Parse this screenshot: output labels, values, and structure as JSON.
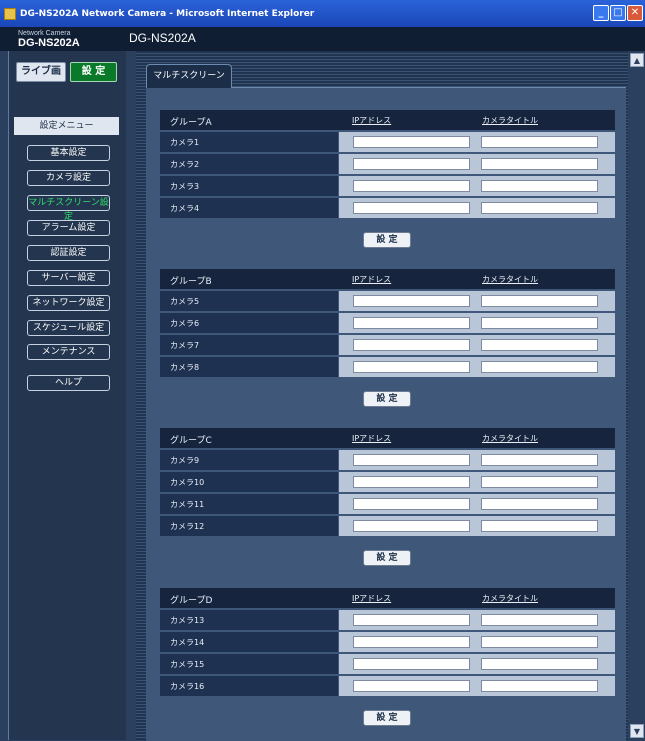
{
  "window": {
    "title": "DG-NS202A Network Camera - Microsoft Internet Explorer"
  },
  "header": {
    "brand_small": "Network Camera",
    "brand": "DG-NS202A",
    "title": "DG-NS202A"
  },
  "modes": {
    "live": "ライブ画",
    "setup": "設 定"
  },
  "menu": {
    "title": "設定メニュー",
    "items": [
      "基本設定",
      "カメラ設定",
      "マルチスクリーン設定",
      "アラーム設定",
      "認証設定",
      "サーバー設定",
      "ネットワーク設定",
      "スケジュール設定",
      "メンテナンス",
      "ヘルプ"
    ],
    "active_index": 2
  },
  "tab": "マルチスクリーン",
  "columns": {
    "ip": "IPアドレス",
    "title": "カメラタイトル"
  },
  "groups": [
    {
      "name": "グループA",
      "cameras": [
        "カメラ1",
        "カメラ2",
        "カメラ3",
        "カメラ4"
      ]
    },
    {
      "name": "グループB",
      "cameras": [
        "カメラ5",
        "カメラ6",
        "カメラ7",
        "カメラ8"
      ]
    },
    {
      "name": "グループC",
      "cameras": [
        "カメラ9",
        "カメラ10",
        "カメラ11",
        "カメラ12"
      ]
    },
    {
      "name": "グループD",
      "cameras": [
        "カメラ13",
        "カメラ14",
        "カメラ15",
        "カメラ16"
      ]
    }
  ],
  "set_button": "設 定"
}
